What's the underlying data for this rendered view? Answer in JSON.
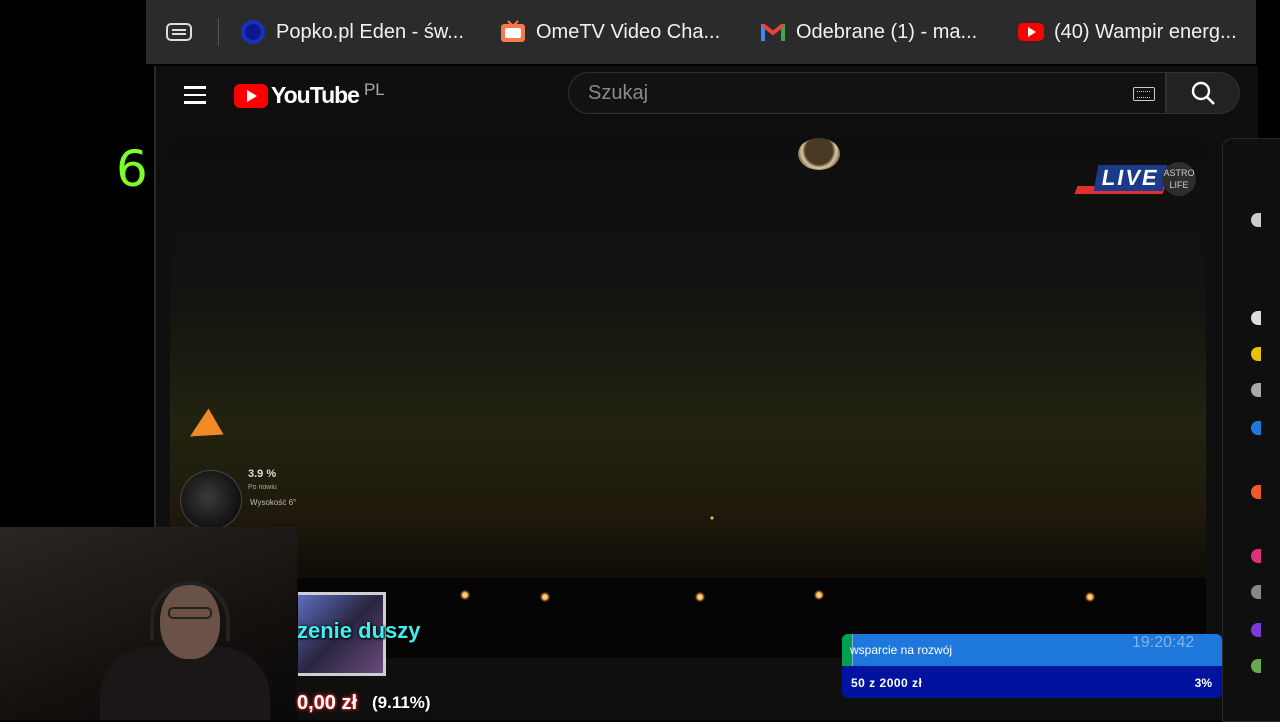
{
  "counter": "6",
  "bookmarks": [
    {
      "label": "Popko.pl Eden - św...",
      "icon": "eden-globe-icon"
    },
    {
      "label": "OmeTV Video Cha...",
      "icon": "ometv-icon"
    },
    {
      "label": "Odebrane (1) - ma...",
      "icon": "gmail-icon"
    },
    {
      "label": "(40) Wampir energ...",
      "icon": "youtube-icon"
    }
  ],
  "youtube": {
    "logo_text": "YouTube",
    "country": "PL",
    "search_placeholder": "Szukaj"
  },
  "video": {
    "live_label": "LIVE",
    "channel_badge": "ASTRO LIFE",
    "moon_pct": "3.9 %",
    "moon_pct_sub": "Po nowiu",
    "moon_alt": "Wysokość 6°"
  },
  "overlay": {
    "song_text": "zenie duszy",
    "amount_text": "0,00 zł",
    "amount_pct": "(9.11%)"
  },
  "goal": {
    "title": "wsparcie na rozwój",
    "time": "19:20:42",
    "sum_text": "50 z 2000 zł",
    "pct_text": "3%",
    "progress": 0.025
  },
  "colors": {
    "counter": "#7dff2a",
    "youtube_red": "#ff0000",
    "goal_bg": "#00129e",
    "goal_bar": "#1e78dc",
    "song": "#3ef0f0"
  }
}
